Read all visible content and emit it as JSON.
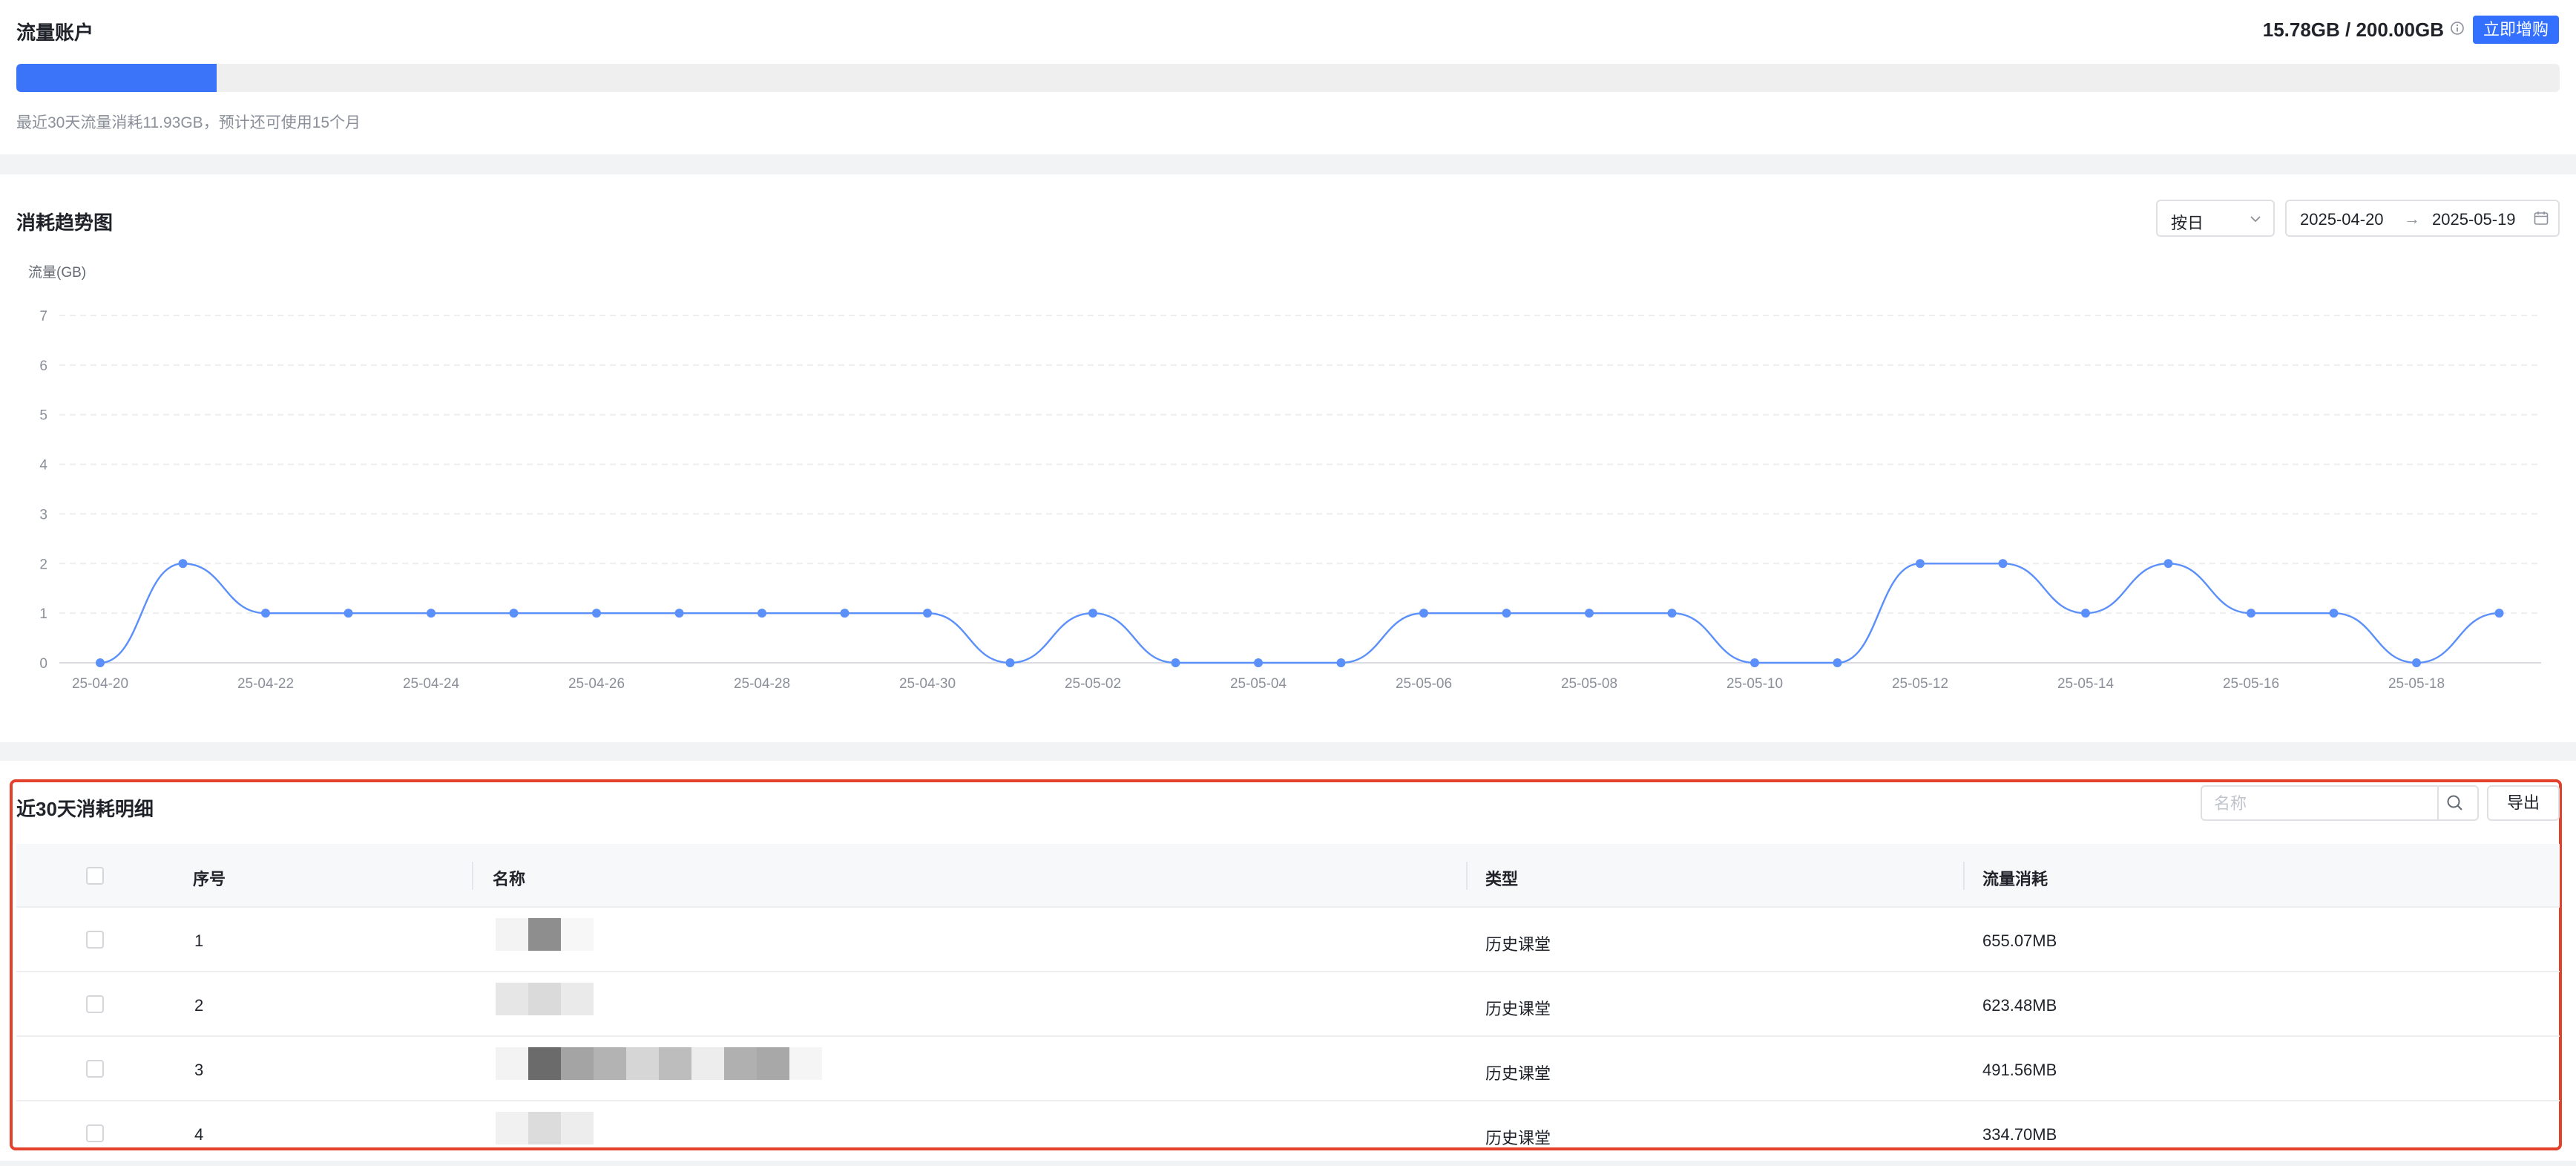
{
  "account": {
    "title": "流量账户",
    "quota": "15.78GB / 200.00GB",
    "buy_label": "立即增购",
    "used_fraction": 0.0789,
    "note": "最近30天流量消耗11.93GB，预计还可使用15个月",
    "accent": "#3b74f8"
  },
  "trend": {
    "title": "消耗趋势图",
    "granularity": "按日",
    "date_start": "2025-04-20",
    "date_arrow": "→",
    "date_end": "2025-05-19"
  },
  "chart_data": {
    "type": "line",
    "ylabel": "流量(GB)",
    "ylim": [
      0,
      7
    ],
    "yticks": [
      0,
      1,
      2,
      3,
      4,
      5,
      6,
      7
    ],
    "x": [
      "25-04-20",
      "25-04-21",
      "25-04-22",
      "25-04-23",
      "25-04-24",
      "25-04-25",
      "25-04-26",
      "25-04-27",
      "25-04-28",
      "25-04-29",
      "25-04-30",
      "25-05-01",
      "25-05-02",
      "25-05-03",
      "25-05-04",
      "25-05-05",
      "25-05-06",
      "25-05-07",
      "25-05-08",
      "25-05-09",
      "25-05-10",
      "25-05-11",
      "25-05-12",
      "25-05-13",
      "25-05-14",
      "25-05-15",
      "25-05-16",
      "25-05-17",
      "25-05-18",
      "25-05-19"
    ],
    "xtick_labels": [
      "25-04-20",
      "25-04-22",
      "25-04-24",
      "25-04-26",
      "25-04-28",
      "25-04-30",
      "25-05-02",
      "25-05-04",
      "25-05-06",
      "25-05-08",
      "25-05-10",
      "25-05-12",
      "25-05-14",
      "25-05-16",
      "25-05-18"
    ],
    "values": [
      0,
      2,
      1,
      1,
      1,
      1,
      1,
      1,
      1,
      1,
      1,
      0,
      1,
      0,
      0,
      0,
      1,
      1,
      1,
      1,
      0,
      0,
      2,
      2,
      1,
      2,
      1,
      1,
      0,
      1
    ],
    "color": "#5b8ff9",
    "grid": true
  },
  "detail": {
    "title": "近30天消耗明细",
    "search_placeholder": "名称",
    "export_label": "导出",
    "columns": [
      "序号",
      "名称",
      "类型",
      "流量消耗"
    ],
    "rows": [
      {
        "index": "1",
        "type": "历史课堂",
        "usage": "655.07MB"
      },
      {
        "index": "2",
        "type": "历史课堂",
        "usage": "623.48MB"
      },
      {
        "index": "3",
        "type": "历史课堂",
        "usage": "491.56MB"
      },
      {
        "index": "4",
        "type": "历史课堂",
        "usage": "334.70MB"
      }
    ]
  }
}
